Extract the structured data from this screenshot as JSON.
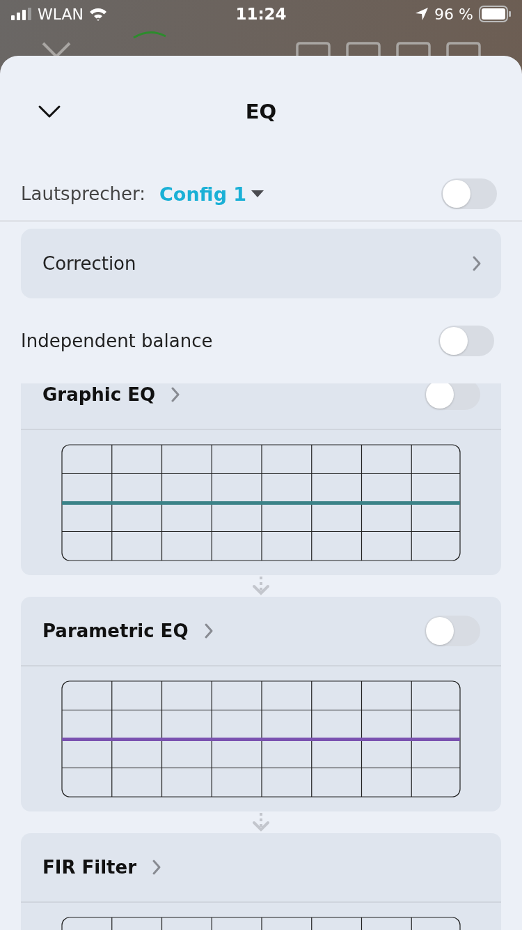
{
  "status_bar": {
    "carrier": "WLAN",
    "time": "11:24",
    "battery": "96 %"
  },
  "sheet": {
    "title": "EQ",
    "speaker_row": {
      "label": "Lautsprecher:",
      "value": "Config 1",
      "on": false
    },
    "correction": {
      "label": "Correction"
    },
    "balance_row": {
      "label": "Independent balance",
      "on": false
    },
    "sections": [
      {
        "title": "Graphic EQ",
        "on": false,
        "color": "#3a8287"
      },
      {
        "title": "Parametric EQ",
        "on": false,
        "color": "#7a52b0"
      },
      {
        "title": "FIR Filter"
      }
    ]
  }
}
